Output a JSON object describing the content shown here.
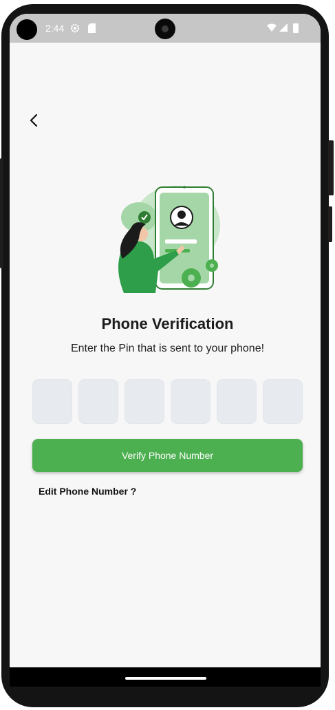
{
  "status_bar": {
    "time": "2:44",
    "icons": [
      "settings-gear-icon",
      "sd-card-icon",
      "wifi-icon",
      "cell-signal-icon",
      "battery-icon"
    ]
  },
  "navigation": {
    "back_icon": "chevron-left-icon"
  },
  "illustration": {
    "icon": "phone-verification-illustration",
    "accent": "#4caf50"
  },
  "content": {
    "title": "Phone Verification",
    "subtitle": "Enter the Pin that is sent to your phone!"
  },
  "pin": {
    "digits": [
      "",
      "",
      "",
      "",
      "",
      ""
    ]
  },
  "actions": {
    "verify_label": "Verify Phone Number",
    "edit_label": "Edit Phone Number ?"
  },
  "colors": {
    "accent": "#4caf50",
    "pin_box": "#e7ebef",
    "background": "#f7f7f7",
    "status_bar": "#c6c6c6"
  }
}
